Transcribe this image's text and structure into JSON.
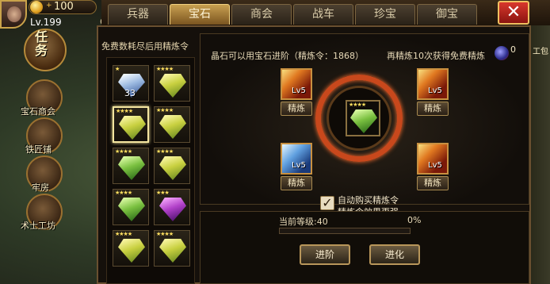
{
  "hud": {
    "gold_value": "100",
    "plus_glyph": "+",
    "level_prefix": "Lv.",
    "level_value": "199",
    "cut_text": "6"
  },
  "side_menu": {
    "task_label": "任务",
    "items": [
      {
        "label": "宝石商会"
      },
      {
        "label": "铁匠铺"
      },
      {
        "label": "牢房"
      },
      {
        "label": "术士工坊"
      }
    ]
  },
  "tabs": [
    {
      "label": "兵器",
      "active": false
    },
    {
      "label": "宝石",
      "active": true
    },
    {
      "label": "商会",
      "active": false
    },
    {
      "label": "战车",
      "active": false
    },
    {
      "label": "珍宝",
      "active": false
    },
    {
      "label": "御宝",
      "active": false
    }
  ],
  "close_glyph": "✕",
  "left_panel": {
    "header": "免费数耗尽后用精炼令",
    "gems": [
      {
        "color": "blue",
        "stars": "★",
        "count": "33",
        "selected": false
      },
      {
        "color": "yellow",
        "stars": "★★★★",
        "count": "",
        "selected": false
      },
      {
        "color": "yellow",
        "stars": "★★★★",
        "count": "",
        "selected": true
      },
      {
        "color": "yellow",
        "stars": "★★★★",
        "count": "",
        "selected": false
      },
      {
        "color": "green",
        "stars": "★★★★",
        "count": "",
        "selected": false
      },
      {
        "color": "yellow",
        "stars": "★★★★",
        "count": "",
        "selected": false
      },
      {
        "color": "green",
        "stars": "★★★★",
        "count": "",
        "selected": false
      },
      {
        "color": "purple",
        "stars": "★★★",
        "count": "",
        "selected": false
      },
      {
        "color": "yellow",
        "stars": "★★★★",
        "count": "",
        "selected": false
      },
      {
        "color": "yellow",
        "stars": "★★★★",
        "count": "",
        "selected": false
      }
    ]
  },
  "main": {
    "crystal_text": "晶石可以用宝石进阶（精炼令：1868）",
    "free_text": "再精炼10次获得免费精炼",
    "free_icon": "gem-orb-icon",
    "free_count": "0",
    "center_stars": "★★★★",
    "skills": [
      {
        "type": "fire",
        "level": "Lv5",
        "button": "精炼"
      },
      {
        "type": "fire",
        "level": "Lv5",
        "button": "精炼"
      },
      {
        "type": "ice",
        "level": "Lv5",
        "button": "精炼"
      },
      {
        "type": "fire",
        "level": "Lv5",
        "button": "精炼"
      }
    ],
    "auto_buy_text": "自动购买精炼令",
    "auto_buy_checked": true,
    "effect_text": "精炼令效果更强",
    "current_level_text": "当前等级:40",
    "progress_text": "0%",
    "progress_value": 0,
    "advance_button": "进阶",
    "evolve_button": "进化"
  },
  "right_edge_label": "工包"
}
